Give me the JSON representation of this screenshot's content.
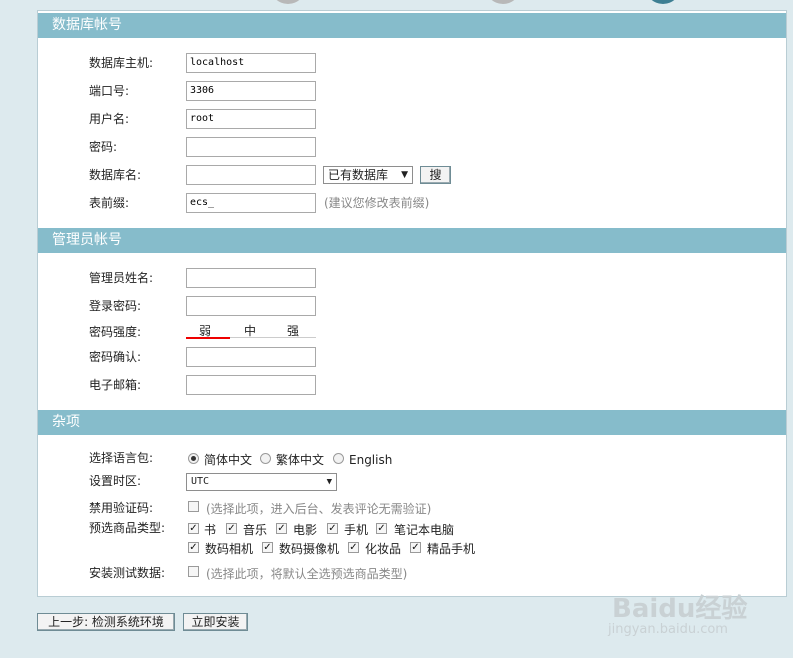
{
  "db_section": {
    "title": "数据库帐号",
    "host_label": "数据库主机:",
    "host_value": "localhost",
    "port_label": "端口号:",
    "port_value": "3306",
    "user_label": "用户名:",
    "user_value": "root",
    "pass_label": "密码:",
    "pass_value": "",
    "dbname_label": "数据库名:",
    "dbname_value": "",
    "existing_db_select": "已有数据库",
    "search_button": "搜",
    "prefix_label": "表前缀:",
    "prefix_value": "ecs_",
    "prefix_hint": "(建议您修改表前缀)"
  },
  "admin_section": {
    "title": "管理员帐号",
    "name_label": "管理员姓名:",
    "name_value": "",
    "password_label": "登录密码:",
    "password_value": "",
    "strength_label": "密码强度:",
    "strength_levels": [
      "弱",
      "中",
      "强"
    ],
    "confirm_label": "密码确认:",
    "confirm_value": "",
    "email_label": "电子邮箱:",
    "email_value": ""
  },
  "misc_section": {
    "title": "杂项",
    "lang_label": "选择语言包:",
    "lang_options": [
      "简体中文",
      "繁体中文",
      "English"
    ],
    "lang_selected": "简体中文",
    "tz_label": "设置时区:",
    "tz_value": "UTC",
    "captcha_label": "禁用验证码:",
    "captcha_hint": "(选择此项，进入后台、发表评论无需验证)",
    "goods_label": "预选商品类型:",
    "goods_types": [
      "书",
      "音乐",
      "电影",
      "手机",
      "笔记本电脑",
      "数码相机",
      "数码摄像机",
      "化妆品",
      "精品手机"
    ],
    "testdata_label": "安装测试数据:",
    "testdata_hint": "(选择此项，将默认全选预选商品类型)"
  },
  "footer": {
    "prev_button": "上一步: 检测系统环境",
    "install_button": "立即安装"
  },
  "watermark": {
    "brand": "Baidu经验",
    "url": "jingyan.baidu.com"
  },
  "colors": {
    "section_header": "#86bccb",
    "background": "#ddeaee",
    "strength_bar": "#e00000"
  }
}
